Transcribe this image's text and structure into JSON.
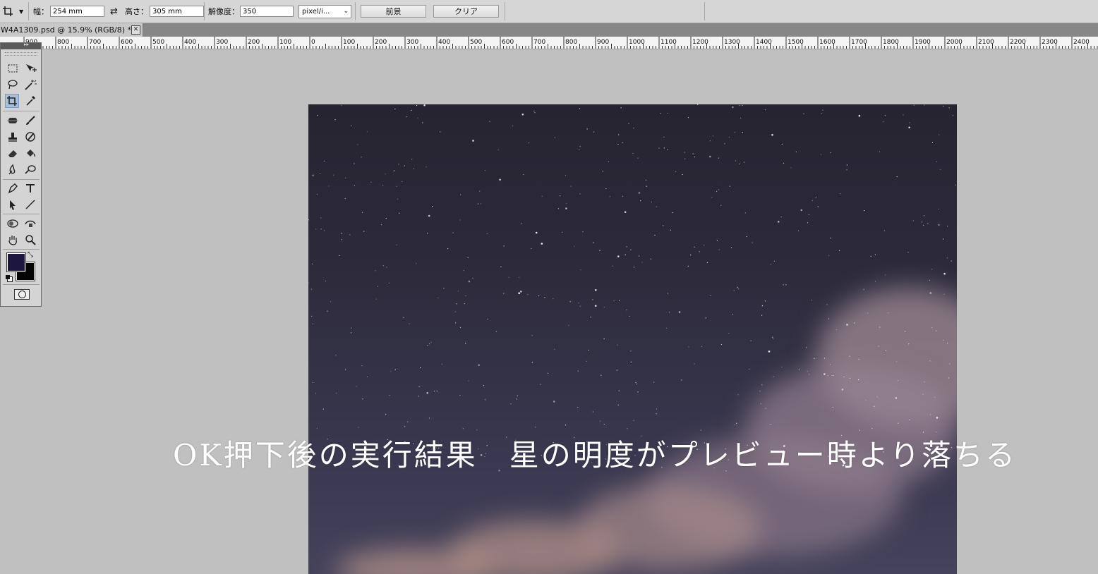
{
  "options_bar": {
    "tool_icon": "crop-icon",
    "width_label": "幅：",
    "width_value": "254 mm",
    "swap_icon": "swap-arrows-icon",
    "height_label": "高さ：",
    "height_value": "305 mm",
    "resolution_label": "解像度：",
    "resolution_value": "350",
    "unit_value": "pixel/i...",
    "front_image_button": "前景",
    "clear_button": "クリア"
  },
  "document_tab": {
    "title": "W4A1309.psd @ 15.9% (RGB/8) *",
    "close_label": "✕"
  },
  "ruler": {
    "labels": [
      "900",
      "800",
      "700",
      "600",
      "500",
      "400",
      "300",
      "200",
      "100",
      "0",
      "100",
      "200",
      "300",
      "400",
      "500",
      "600",
      "700",
      "800",
      "900",
      "1000",
      "1100",
      "1200",
      "1300",
      "1400",
      "1500",
      "1600",
      "1700",
      "1800",
      "1900",
      "2000",
      "2100",
      "2200",
      "2300",
      "2400"
    ]
  },
  "tools_panel": {
    "tools": [
      "rect-marquee-icon",
      "move-icon",
      "lasso-icon",
      "magic-wand-icon",
      "crop-icon",
      "eyedropper-icon",
      "spot-healing-icon",
      "brush-icon",
      "clone-stamp-icon",
      "history-brush-icon",
      "eraser-icon",
      "paint-bucket-icon",
      "blur-icon",
      "dodge-icon",
      "pen-icon",
      "type-icon",
      "path-select-icon",
      "line-icon",
      "3d-rotate-icon",
      "3d-orbit-icon",
      "hand-icon",
      "zoom-icon"
    ],
    "foreground_color": "#1c1640",
    "background_color": "#050505"
  },
  "canvas": {
    "overlay_text": "OK押下後の実行結果　星の明度がプレビュー時より落ちる"
  }
}
